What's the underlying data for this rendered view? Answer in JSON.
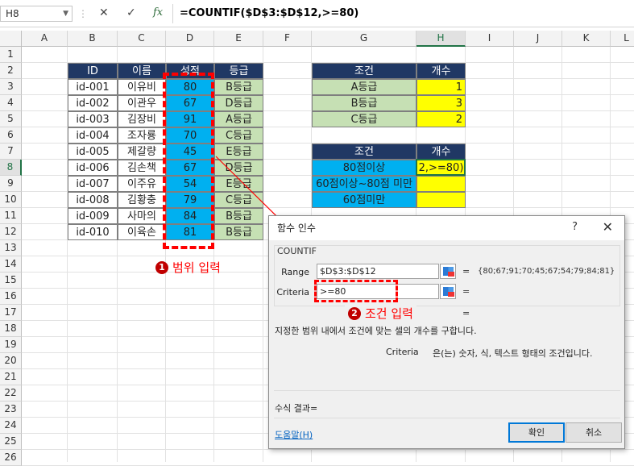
{
  "formula_bar": {
    "name_box": "H8",
    "cancel_icon": "✕",
    "enter_icon": "✓",
    "fx_icon": "fx",
    "formula": "=COUNTIF($D$3:$D$12,>=80)"
  },
  "columns": [
    "A",
    "B",
    "C",
    "D",
    "E",
    "F",
    "G",
    "H",
    "I",
    "J",
    "K",
    "L"
  ],
  "rows": [
    "1",
    "2",
    "3",
    "4",
    "5",
    "6",
    "7",
    "8",
    "9",
    "10",
    "11",
    "12",
    "13",
    "14",
    "15",
    "16",
    "17",
    "18",
    "19",
    "20",
    "21",
    "22",
    "23",
    "24",
    "25",
    "26"
  ],
  "table1": {
    "headers": [
      "ID",
      "이름",
      "성적",
      "등급"
    ],
    "rows": [
      [
        "id-001",
        "이유비",
        "80",
        "B등급"
      ],
      [
        "id-002",
        "이관우",
        "67",
        "D등급"
      ],
      [
        "id-003",
        "김장비",
        "91",
        "A등급"
      ],
      [
        "id-004",
        "조자룡",
        "70",
        "C등급"
      ],
      [
        "id-005",
        "제갈량",
        "45",
        "E등급"
      ],
      [
        "id-006",
        "김손책",
        "67",
        "D등급"
      ],
      [
        "id-007",
        "이주유",
        "54",
        "E등급"
      ],
      [
        "id-008",
        "김황충",
        "79",
        "C등급"
      ],
      [
        "id-009",
        "사마의",
        "84",
        "B등급"
      ],
      [
        "id-010",
        "이육손",
        "81",
        "B등급"
      ]
    ]
  },
  "table2": {
    "headers": [
      "조건",
      "개수"
    ],
    "rows": [
      [
        "A등급",
        "1"
      ],
      [
        "B등급",
        "3"
      ],
      [
        "C등급",
        "2"
      ]
    ]
  },
  "table3": {
    "headers": [
      "조건",
      "개수"
    ],
    "rows": [
      [
        "80점이상",
        "2,>=80)"
      ],
      [
        "60점이상~80점 미만",
        ""
      ],
      [
        "60점미만",
        ""
      ]
    ]
  },
  "annotations": {
    "a1_num": "1",
    "a1_text": "범위 입력",
    "a2_num": "2",
    "a2_text": "조건 입력"
  },
  "dialog": {
    "title": "함수 인수",
    "help_icon": "?",
    "close_icon": "✕",
    "function_name": "COUNTIF",
    "range_label": "Range",
    "range_value": "$D$3:$D$12",
    "range_result": "{80;67;91;70;45;67;54;79;84;81}",
    "criteria_label": "Criteria",
    "criteria_value": ">=80",
    "equals": "=",
    "description": "지정한 범위 내에서 조건에 맞는 셀의 개수를 구합니다.",
    "arg_desc_name": "Criteria",
    "arg_desc": "은(는) 숫자, 식, 텍스트 형태의 조건입니다.",
    "result_label": "수식 결과=",
    "help_link": "도움말(H)",
    "ok_label": "확인",
    "cancel_label": "취소"
  },
  "colors": {
    "header_dark": "#203864",
    "blue": "#00b0f0",
    "green": "#c6e0b4",
    "yellow": "#ffff00",
    "annotation_red": "#ff0000"
  }
}
